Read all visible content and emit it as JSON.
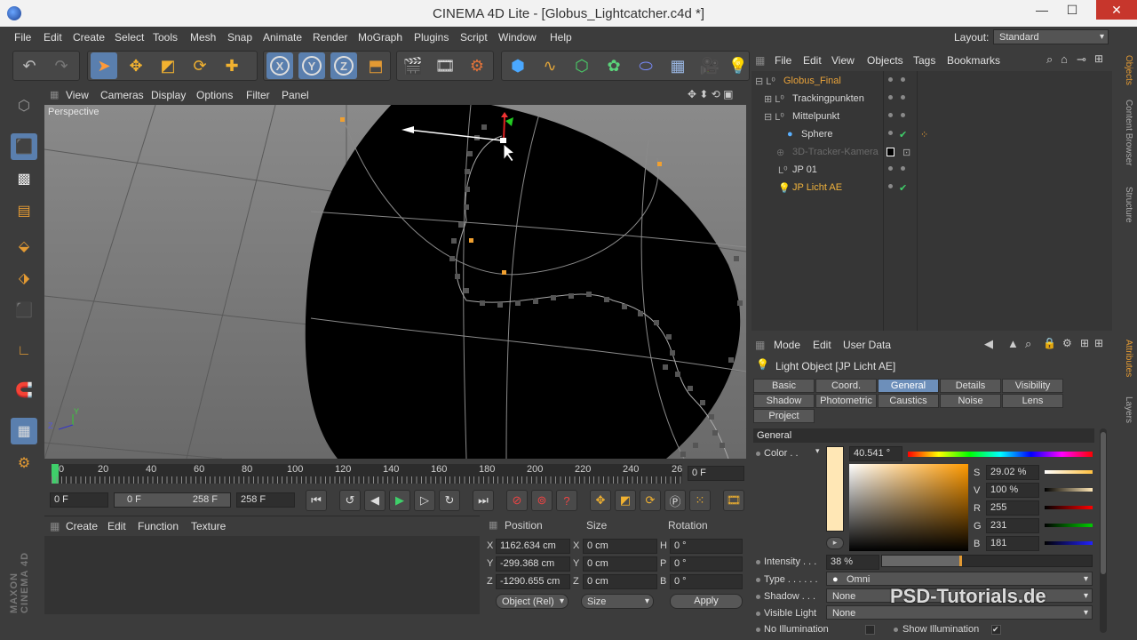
{
  "window": {
    "title": "CINEMA 4D Lite - [Globus_Lightcatcher.c4d *]",
    "minimize": "—",
    "maximize": "☐",
    "close": "✕"
  },
  "menubar": [
    "File",
    "Edit",
    "Create",
    "Select",
    "Tools",
    "Mesh",
    "Snap",
    "Animate",
    "Render",
    "MoGraph",
    "Plugins",
    "Script",
    "Window",
    "Help"
  ],
  "layout": {
    "label": "Layout:",
    "value": "Standard"
  },
  "viewport": {
    "menu": [
      "View",
      "Cameras",
      "Display",
      "Options",
      "Filter",
      "Panel"
    ],
    "label": "Perspective",
    "axis_y": "Y",
    "axis_z": "Z"
  },
  "timeline": {
    "ticks": [
      "0",
      "20",
      "40",
      "60",
      "80",
      "100",
      "120",
      "140",
      "160",
      "180",
      "200",
      "220",
      "240",
      "26"
    ],
    "current_frame": "0 F",
    "start": "0 F",
    "range_start": "0 F",
    "range_end": "258 F",
    "end": "258 F"
  },
  "material_manager": {
    "menu": [
      "Create",
      "Edit",
      "Function",
      "Texture"
    ]
  },
  "coordinates": {
    "headers": [
      "Position",
      "Size",
      "Rotation"
    ],
    "rows": [
      {
        "axis": "X",
        "pos": "1162.634 cm",
        "size_axis": "X",
        "size": "0 cm",
        "rot_axis": "H",
        "rot": "0 °"
      },
      {
        "axis": "Y",
        "pos": "-299.368 cm",
        "size_axis": "Y",
        "size": "0 cm",
        "rot_axis": "P",
        "rot": "0 °"
      },
      {
        "axis": "Z",
        "pos": "-1290.655 cm",
        "size_axis": "Z",
        "size": "0 cm",
        "rot_axis": "B",
        "rot": "0 °"
      }
    ],
    "mode": "Object (Rel)",
    "size_mode": "Size",
    "apply": "Apply"
  },
  "object_manager": {
    "menu": [
      "File",
      "Edit",
      "View",
      "Objects",
      "Tags",
      "Bookmarks"
    ],
    "objects": [
      {
        "name": "Globus_Final",
        "color": "#e8a23a"
      },
      {
        "name": "Trackingpunkten",
        "color": "#d8d8d8"
      },
      {
        "name": "Mittelpunkt",
        "color": "#d8d8d8"
      },
      {
        "name": "Sphere",
        "color": "#d8d8d8"
      },
      {
        "name": "3D-Tracker-Kamera",
        "color": "#6a6a6a"
      },
      {
        "name": "JP 01",
        "color": "#d8d8d8"
      },
      {
        "name": "JP Licht AE",
        "color": "#f0b23c"
      }
    ]
  },
  "right_tabs": {
    "top": [
      "Objects",
      "Content Browser",
      "Structure"
    ],
    "bottom": [
      "Attributes",
      "Layers"
    ]
  },
  "attributes": {
    "menu": [
      "Mode",
      "Edit",
      "User Data"
    ],
    "object_title": "Light Object [JP Licht AE]",
    "tabs_row1": [
      "Basic",
      "Coord.",
      "General",
      "Details",
      "Visibility"
    ],
    "tabs_row2": [
      "Shadow",
      "Photometric",
      "Caustics",
      "Noise",
      "Lens"
    ],
    "tabs_row3": [
      "Project"
    ],
    "selected_tab": "General",
    "section": "General",
    "color_label": "Color . .",
    "hue": "40.541 °",
    "channels": [
      {
        "label": "S",
        "value": "29.02 %"
      },
      {
        "label": "V",
        "value": "100 %"
      },
      {
        "label": "R",
        "value": "255"
      },
      {
        "label": "G",
        "value": "231"
      },
      {
        "label": "B",
        "value": "181"
      }
    ],
    "intensity_label": "Intensity . . .",
    "intensity": "38 %",
    "intensity_fraction": 0.38,
    "type_label": "Type . . . . . .",
    "type": "Omni",
    "shadow_label": "Shadow . . .",
    "shadow": "None",
    "visible_light_label": "Visible Light",
    "visible_light": "None",
    "no_illumination_label": "No Illumination",
    "show_illumination_label": "Show Illumination",
    "swatch_color": "#ffe7b5"
  },
  "watermark": "PSD-Tutorials.de",
  "brand": "MAXON CINEMA 4D"
}
